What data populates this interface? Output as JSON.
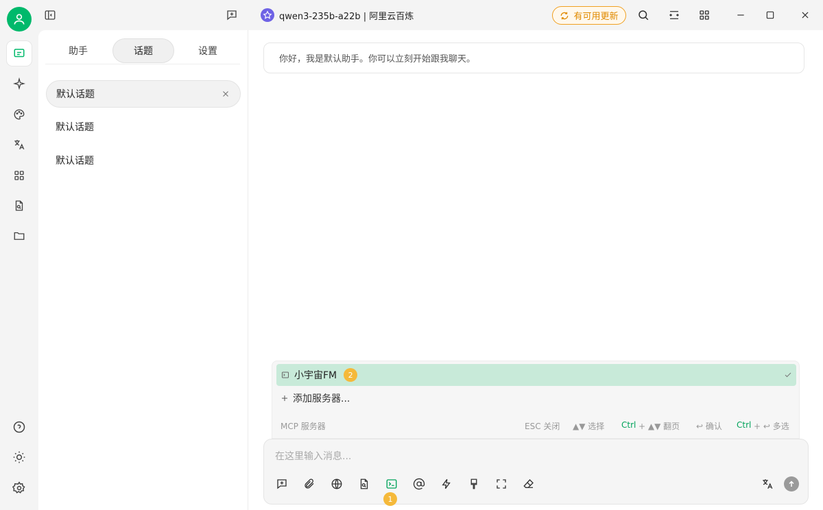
{
  "topbar": {
    "model": "qwen3-235b-a22b | 阿里云百炼",
    "update_label": "有可用更新"
  },
  "panel": {
    "tabs": [
      {
        "label": "助手"
      },
      {
        "label": "话题"
      },
      {
        "label": "设置"
      }
    ],
    "topics": [
      {
        "label": "默认话题"
      },
      {
        "label": "默认话题"
      },
      {
        "label": "默认话题"
      }
    ]
  },
  "main": {
    "greeting": "你好，我是默认助手。你可以立刻开始跟我聊天。",
    "mcp": {
      "server_name": "小宇宙FM",
      "server_badge": "2",
      "add_label": "添加服务器...",
      "footer_title": "MCP 服务器",
      "hint_close": "ESC 关闭",
      "hint_select": "▲▼ 选择",
      "hint_page_key": "Ctrl",
      "hint_page": "+ ▲▼ 翻页",
      "hint_confirm": "↩ 确认",
      "hint_multi_key": "Ctrl",
      "hint_multi": "+ ↩ 多选"
    },
    "input": {
      "placeholder": "在这里输入消息...",
      "tool_badge": "1"
    }
  },
  "colors": {
    "accent": "#00b96b",
    "update": "#e08a00",
    "badge": "#f5b93a",
    "mcp_selected": "#c8ead9"
  }
}
